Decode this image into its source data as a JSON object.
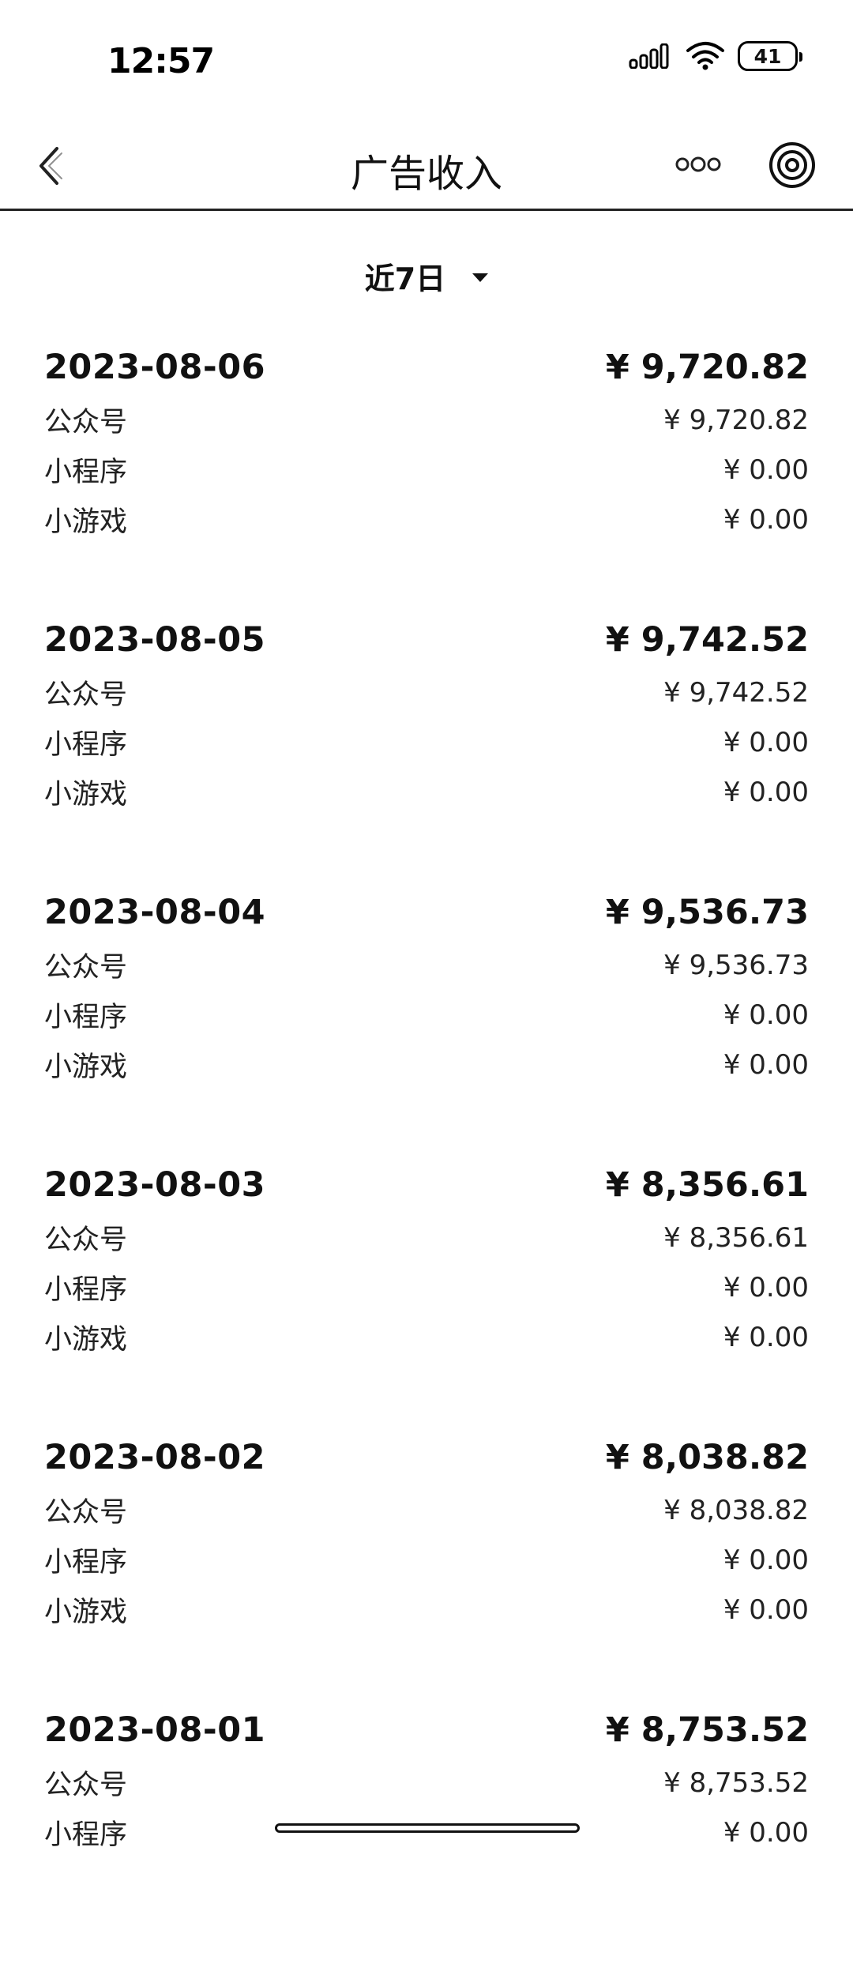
{
  "status_bar": {
    "time": "12:57",
    "battery": "41"
  },
  "nav": {
    "title": "广告收入"
  },
  "filter": {
    "label": "近7日"
  },
  "days": [
    {
      "date": "2023-08-06",
      "total": "¥ 9,720.82",
      "rows": [
        {
          "label": "公众号",
          "amount": "¥ 9,720.82"
        },
        {
          "label": "小程序",
          "amount": "¥ 0.00"
        },
        {
          "label": "小游戏",
          "amount": "¥ 0.00"
        }
      ]
    },
    {
      "date": "2023-08-05",
      "total": "¥ 9,742.52",
      "rows": [
        {
          "label": "公众号",
          "amount": "¥ 9,742.52"
        },
        {
          "label": "小程序",
          "amount": "¥ 0.00"
        },
        {
          "label": "小游戏",
          "amount": "¥ 0.00"
        }
      ]
    },
    {
      "date": "2023-08-04",
      "total": "¥ 9,536.73",
      "rows": [
        {
          "label": "公众号",
          "amount": "¥ 9,536.73"
        },
        {
          "label": "小程序",
          "amount": "¥ 0.00"
        },
        {
          "label": "小游戏",
          "amount": "¥ 0.00"
        }
      ]
    },
    {
      "date": "2023-08-03",
      "total": "¥ 8,356.61",
      "rows": [
        {
          "label": "公众号",
          "amount": "¥ 8,356.61"
        },
        {
          "label": "小程序",
          "amount": "¥ 0.00"
        },
        {
          "label": "小游戏",
          "amount": "¥ 0.00"
        }
      ]
    },
    {
      "date": "2023-08-02",
      "total": "¥ 8,038.82",
      "rows": [
        {
          "label": "公众号",
          "amount": "¥ 8,038.82"
        },
        {
          "label": "小程序",
          "amount": "¥ 0.00"
        },
        {
          "label": "小游戏",
          "amount": "¥ 0.00"
        }
      ]
    },
    {
      "date": "2023-08-01",
      "total": "¥ 8,753.52",
      "rows": [
        {
          "label": "公众号",
          "amount": "¥ 8,753.52"
        },
        {
          "label": "小程序",
          "amount": "¥ 0.00"
        }
      ]
    }
  ]
}
